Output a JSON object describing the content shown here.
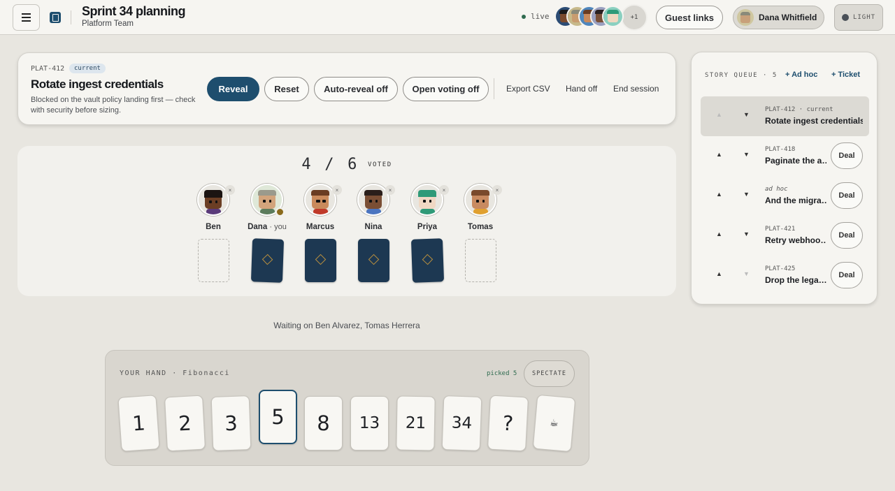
{
  "header": {
    "title": "Sprint 34 planning",
    "team": "Platform Team",
    "live_label": "live",
    "presence_more": "+1",
    "guest_links": "Guest links",
    "user_name": "Dana Whitfield",
    "theme_label": "LIGHT"
  },
  "current_story": {
    "key": "PLAT-412",
    "badge": "current",
    "title": "Rotate ingest credentials",
    "note": "Blocked on the vault policy landing first — check with security before sizing.",
    "actions": {
      "reveal": "Reveal",
      "reset": "Reset",
      "auto_reveal": "Auto-reveal off",
      "open_voting": "Open voting off",
      "export_csv": "Export CSV",
      "hand_off": "Hand off",
      "end_session": "End session"
    }
  },
  "tally": {
    "voted": "4",
    "separator": "/",
    "total": "6",
    "label": "VOTED"
  },
  "players": [
    {
      "name": "Ben",
      "you": "",
      "voted": false,
      "remove": "×"
    },
    {
      "name": "Dana",
      "you": "· you",
      "voted": true,
      "remove": ""
    },
    {
      "name": "Marcus",
      "you": "",
      "voted": true,
      "remove": "×"
    },
    {
      "name": "Nina",
      "you": "",
      "voted": true,
      "remove": "×"
    },
    {
      "name": "Priya",
      "you": "",
      "voted": true,
      "remove": "×"
    },
    {
      "name": "Tomas",
      "you": "",
      "voted": false,
      "remove": "×"
    }
  ],
  "waiting_text": "Waiting on Ben Alvarez, Tomas Herrera",
  "hand": {
    "label": "YOUR HAND · Fibonacci",
    "picked": "picked 5",
    "spectate": "SPECTATE",
    "cards": [
      "1",
      "2",
      "3",
      "5",
      "8",
      "13",
      "21",
      "34",
      "?",
      "☕"
    ],
    "selected": "5"
  },
  "queue": {
    "label": "STORY QUEUE · 5",
    "add_adhoc": "+ Ad hoc",
    "add_ticket": "+ Ticket",
    "up_arrow": "▲",
    "down_arrow": "▼",
    "items": [
      {
        "key": "PLAT-412 · current",
        "title": "Rotate ingest credentials",
        "current": true,
        "deal": ""
      },
      {
        "key": "PLAT-418",
        "title": "Paginate the a…",
        "current": false,
        "deal": "Deal"
      },
      {
        "key": "ad hoc",
        "title": "And the migra…",
        "current": false,
        "deal": "Deal"
      },
      {
        "key": "PLAT-421",
        "title": "Retry webhoo…",
        "current": false,
        "deal": "Deal"
      },
      {
        "key": "PLAT-425",
        "title": "Drop the lega…",
        "current": false,
        "deal": "Deal"
      }
    ]
  },
  "colors": {
    "accent": "#1e4e6e",
    "live": "#2f6b4f",
    "card_back": "#1d3852"
  }
}
